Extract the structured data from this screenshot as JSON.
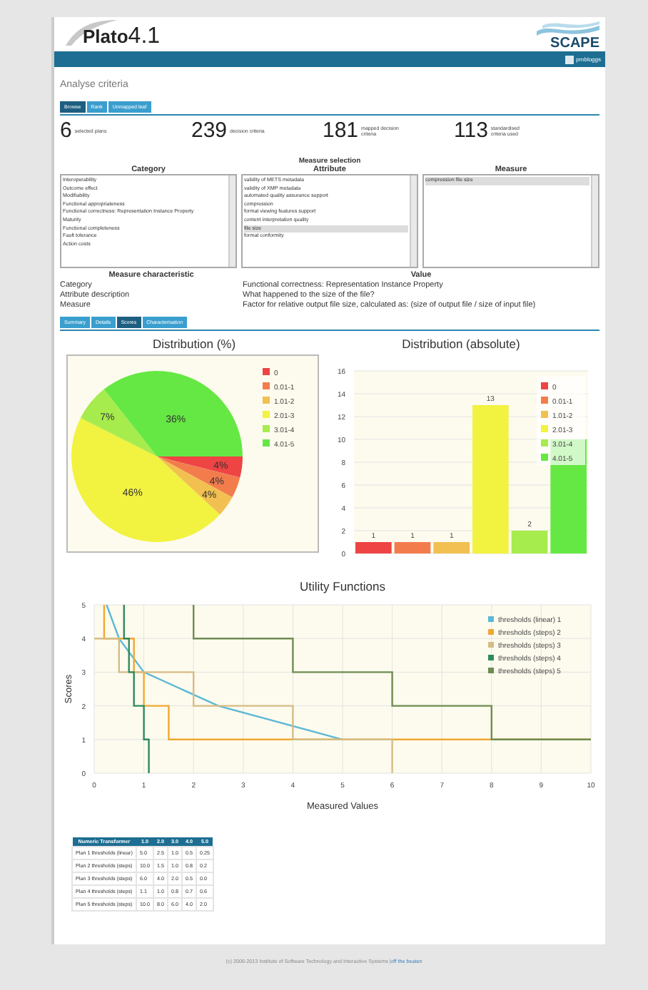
{
  "header": {
    "logo_name": "Plato",
    "logo_version": "4.1",
    "partner_logo": "SCAPE",
    "user": "pmbloggs"
  },
  "page_title": "Analyse criteria",
  "tabs": [
    {
      "label": "Browse",
      "selected": true
    },
    {
      "label": "Rank",
      "selected": false
    },
    {
      "label": "Unmapped leaf",
      "selected": false
    }
  ],
  "stats": [
    {
      "value": "6",
      "label": "selected plans"
    },
    {
      "value": "239",
      "label": "decision criteria"
    },
    {
      "value": "181",
      "label": "mapped decision criteria"
    },
    {
      "value": "113",
      "label": "standardised criteria used"
    }
  ],
  "measure_selection": {
    "title": "Measure selection",
    "columns": [
      {
        "heading": "Category",
        "items": [
          {
            "label": "Interoperability",
            "selected": false
          },
          {
            "label": "Outcome effect",
            "selected": false
          },
          {
            "label": "Modifiability",
            "selected": false
          },
          {
            "label": "Functional appropriateness",
            "selected": false
          },
          {
            "label": "Functional correctness: Representation Instance Property",
            "selected": false
          },
          {
            "label": "Maturity",
            "selected": false
          },
          {
            "label": "Functional completeness",
            "selected": false
          },
          {
            "label": "Fault tolerance",
            "selected": false
          },
          {
            "label": "Action costs",
            "selected": false
          }
        ]
      },
      {
        "heading": "Attribute",
        "items": [
          {
            "label": "validity of METS metadata",
            "selected": false
          },
          {
            "label": "validity of XMP metadata",
            "selected": false
          },
          {
            "label": "automated quality assurance support",
            "selected": false
          },
          {
            "label": "compression",
            "selected": false
          },
          {
            "label": "format viewing features support",
            "selected": false
          },
          {
            "label": "content interpretation quality",
            "selected": false
          },
          {
            "label": "file size",
            "selected": true
          },
          {
            "label": "format conformity",
            "selected": false
          }
        ]
      },
      {
        "heading": "Measure",
        "items": [
          {
            "label": "compression file size",
            "selected": true
          }
        ]
      }
    ]
  },
  "characteristics": {
    "columns": [
      "Measure characteristic",
      "Value"
    ],
    "rows": [
      [
        "Category",
        "Functional correctness: Representation Instance Property"
      ],
      [
        "Attribute description",
        "What happened to the size of the file?"
      ],
      [
        "Measure",
        "Factor for relative output file size, calculated as: (size of output file / size of input file)"
      ]
    ]
  },
  "subtabs": [
    {
      "label": "Summary",
      "selected": false
    },
    {
      "label": "Details",
      "selected": false
    },
    {
      "label": "Scores",
      "selected": true
    },
    {
      "label": "Characterisation",
      "selected": false
    }
  ],
  "pie": {
    "chart_data": {
      "type": "pie",
      "title": "Distribution (%)",
      "legend": "right",
      "categories": [
        "0",
        "0.01-1",
        "1.01-2",
        "2.01-3",
        "3.01-4",
        "4.01-5"
      ],
      "colors": [
        "#ee4444",
        "#f37c4c",
        "#f2c050",
        "#f2f240",
        "#a6ec4c",
        "#66e844"
      ],
      "values": [
        4,
        4,
        4,
        46,
        7,
        36
      ],
      "value_labels": [
        "4%",
        "4%",
        "4%",
        "46%",
        "7%",
        "36%"
      ]
    }
  },
  "bar": {
    "chart_data": {
      "type": "bar",
      "title": "Distribution (absolute)",
      "legend": "right",
      "grid": true,
      "series": [
        {
          "name": "0",
          "color": "#ee4444",
          "values": [
            1
          ]
        },
        {
          "name": "0.01-1",
          "color": "#f37c4c",
          "values": [
            1
          ]
        },
        {
          "name": "1.01-2",
          "color": "#f2c050",
          "values": [
            1
          ]
        },
        {
          "name": "2.01-3",
          "color": "#f2f240",
          "values": [
            13
          ]
        },
        {
          "name": "3.01-4",
          "color": "#a6ec4c",
          "values": [
            2
          ]
        },
        {
          "name": "4.01-5",
          "color": "#66e844",
          "values": [
            10
          ]
        }
      ],
      "ylim": [
        0,
        16
      ],
      "yticks": [
        0,
        2,
        4,
        6,
        8,
        10,
        12,
        14,
        16
      ],
      "value_labels": [
        "1",
        "1",
        "1",
        "13",
        "2",
        null
      ]
    }
  },
  "utility": {
    "chart_data": {
      "type": "line",
      "title": "Utility Functions",
      "legend": "right",
      "grid": true,
      "xlabel": "Measured Values",
      "ylabel": "Scores",
      "xlim": [
        0,
        10
      ],
      "ylim": [
        0,
        5
      ],
      "xticks": [
        0,
        1,
        2,
        3,
        4,
        5,
        6,
        7,
        8,
        9,
        10
      ],
      "yticks": [
        0,
        1,
        2,
        3,
        4,
        5
      ],
      "series": [
        {
          "name": "thresholds (linear) 1",
          "color": "#5bb8d6",
          "x": [
            0.25,
            0.5,
            1,
            2.5,
            5
          ],
          "values": [
            5,
            4,
            3,
            2,
            1
          ]
        },
        {
          "name": "thresholds (steps) 2",
          "color": "#f0a832",
          "x": [
            0.2,
            0.2,
            0.8,
            0.8,
            1,
            1,
            1.5,
            1.5,
            10
          ],
          "values": [
            5,
            4,
            4,
            3,
            3,
            2,
            2,
            1,
            1
          ]
        },
        {
          "name": "thresholds (steps) 3",
          "color": "#d6bc84",
          "x": [
            0,
            0.5,
            0.5,
            2,
            2,
            4,
            4,
            6,
            6
          ],
          "values": [
            4,
            4,
            3,
            3,
            2,
            2,
            1,
            1,
            0
          ]
        },
        {
          "name": "thresholds (steps) 4",
          "color": "#2f8a5e",
          "x": [
            0.6,
            0.6,
            0.7,
            0.7,
            0.8,
            0.8,
            1,
            1,
            1.1,
            1.1
          ],
          "values": [
            5,
            4,
            4,
            3,
            3,
            2,
            2,
            1,
            1,
            0
          ]
        },
        {
          "name": "thresholds (steps) 5",
          "color": "#6e8c52",
          "x": [
            2,
            2,
            4,
            4,
            6,
            6,
            8,
            8,
            10
          ],
          "values": [
            5,
            4,
            4,
            3,
            3,
            2,
            2,
            1,
            1
          ]
        }
      ]
    }
  },
  "table": {
    "columns": [
      "Numeric Transformer",
      "1.0",
      "2.0",
      "3.0",
      "4.0",
      "5.0"
    ],
    "rows": [
      [
        "Plan 1 thresholds (linear)",
        "5.0",
        "2.5",
        "1.0",
        "0.5",
        "0.25"
      ],
      [
        "Plan 2 thresholds (steps)",
        "10.0",
        "1.5",
        "1.0",
        "0.8",
        "0.2"
      ],
      [
        "Plan 3 thresholds (steps)",
        "6.0",
        "4.0",
        "2.0",
        "0.5",
        "0.0"
      ],
      [
        "Plan 4 thresholds (steps)",
        "1.1",
        "1.0",
        "0.8",
        "0.7",
        "0.6"
      ],
      [
        "Plan 5 thresholds (steps)",
        "10.0",
        "8.0",
        "6.0",
        "4.0",
        "2.0"
      ]
    ]
  },
  "footer": {
    "text": "(c) 2006-2013 Institute of Software Technology and Interactive Systems |",
    "link": "off the beaten"
  }
}
